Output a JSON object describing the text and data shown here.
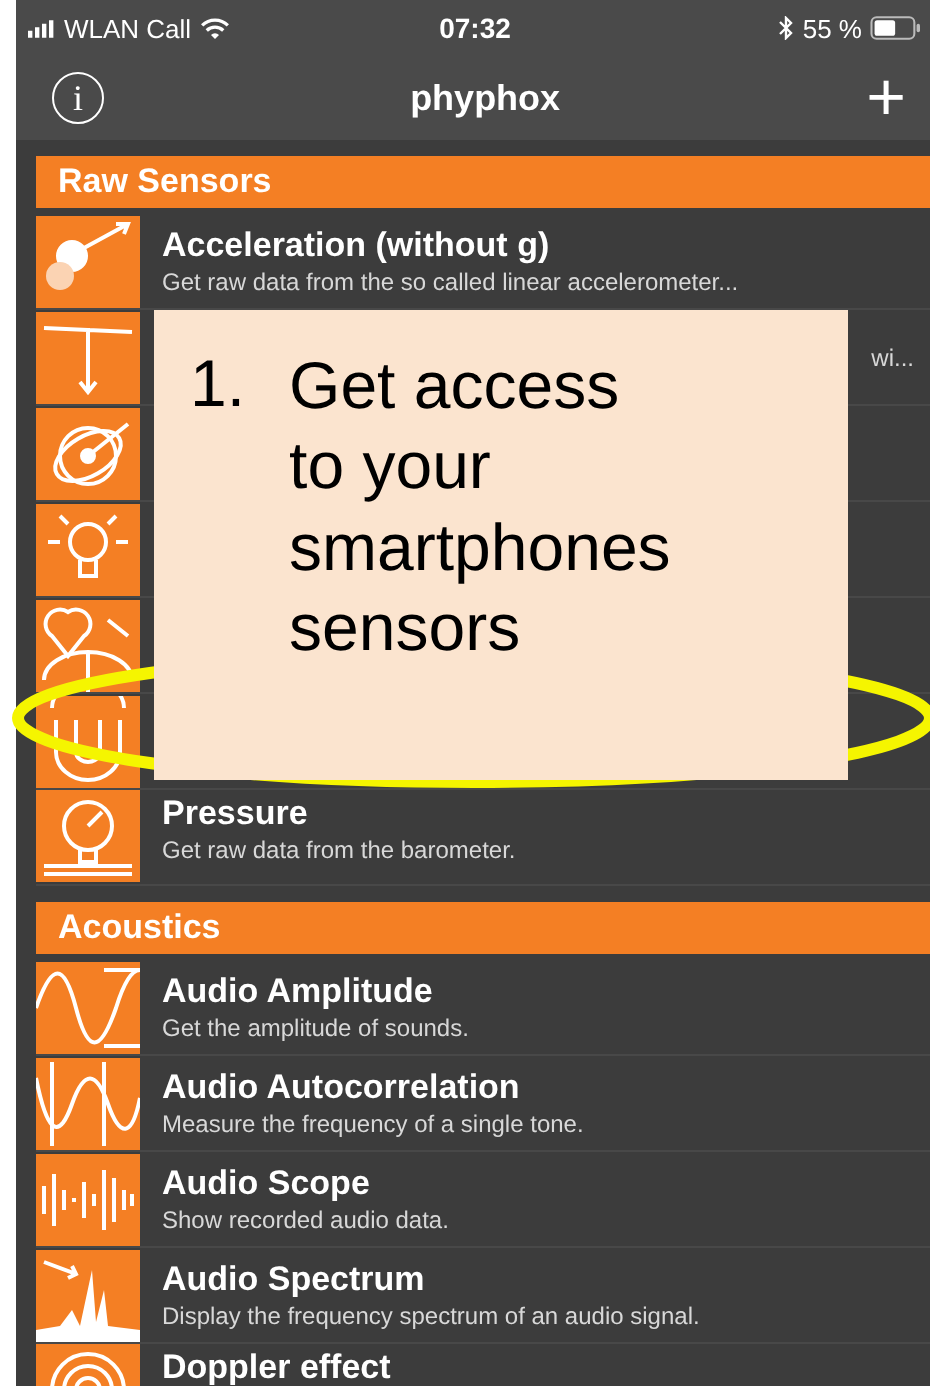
{
  "status_bar": {
    "carrier": "WLAN Call",
    "time": "07:32",
    "battery": "55 %"
  },
  "nav_bar": {
    "info": "i",
    "title": "phyphox",
    "add": "+"
  },
  "sections": [
    {
      "title": "Raw Sensors",
      "items": [
        {
          "kind": "experiment",
          "title": "Acceleration (without g)",
          "description": "Get raw data from the so called linear accelerometer..."
        },
        {
          "kind": "experiment",
          "description": "wi..."
        },
        {
          "kind": "covered"
        },
        {
          "kind": "covered"
        },
        {
          "kind": "covered"
        },
        {
          "kind": "covered"
        },
        {
          "kind": "experiment",
          "title": "Pressure",
          "description": "Get raw data from the barometer."
        }
      ]
    },
    {
      "title": "Acoustics",
      "items": [
        {
          "kind": "experiment",
          "title": "Audio Amplitude",
          "description": "Get the amplitude of sounds."
        },
        {
          "kind": "experiment",
          "title": "Audio Autocorrelation",
          "description": "Measure the frequency of a single tone."
        },
        {
          "kind": "experiment",
          "title": "Audio Scope",
          "description": "Show recorded audio data."
        },
        {
          "kind": "experiment",
          "title": "Audio Spectrum",
          "description": "Display the frequency spectrum of an audio signal."
        },
        {
          "kind": "experiment",
          "title": "Doppler effect"
        }
      ]
    }
  ],
  "callout": {
    "number": "1.",
    "text": "Get access to your smartphones sensors"
  }
}
